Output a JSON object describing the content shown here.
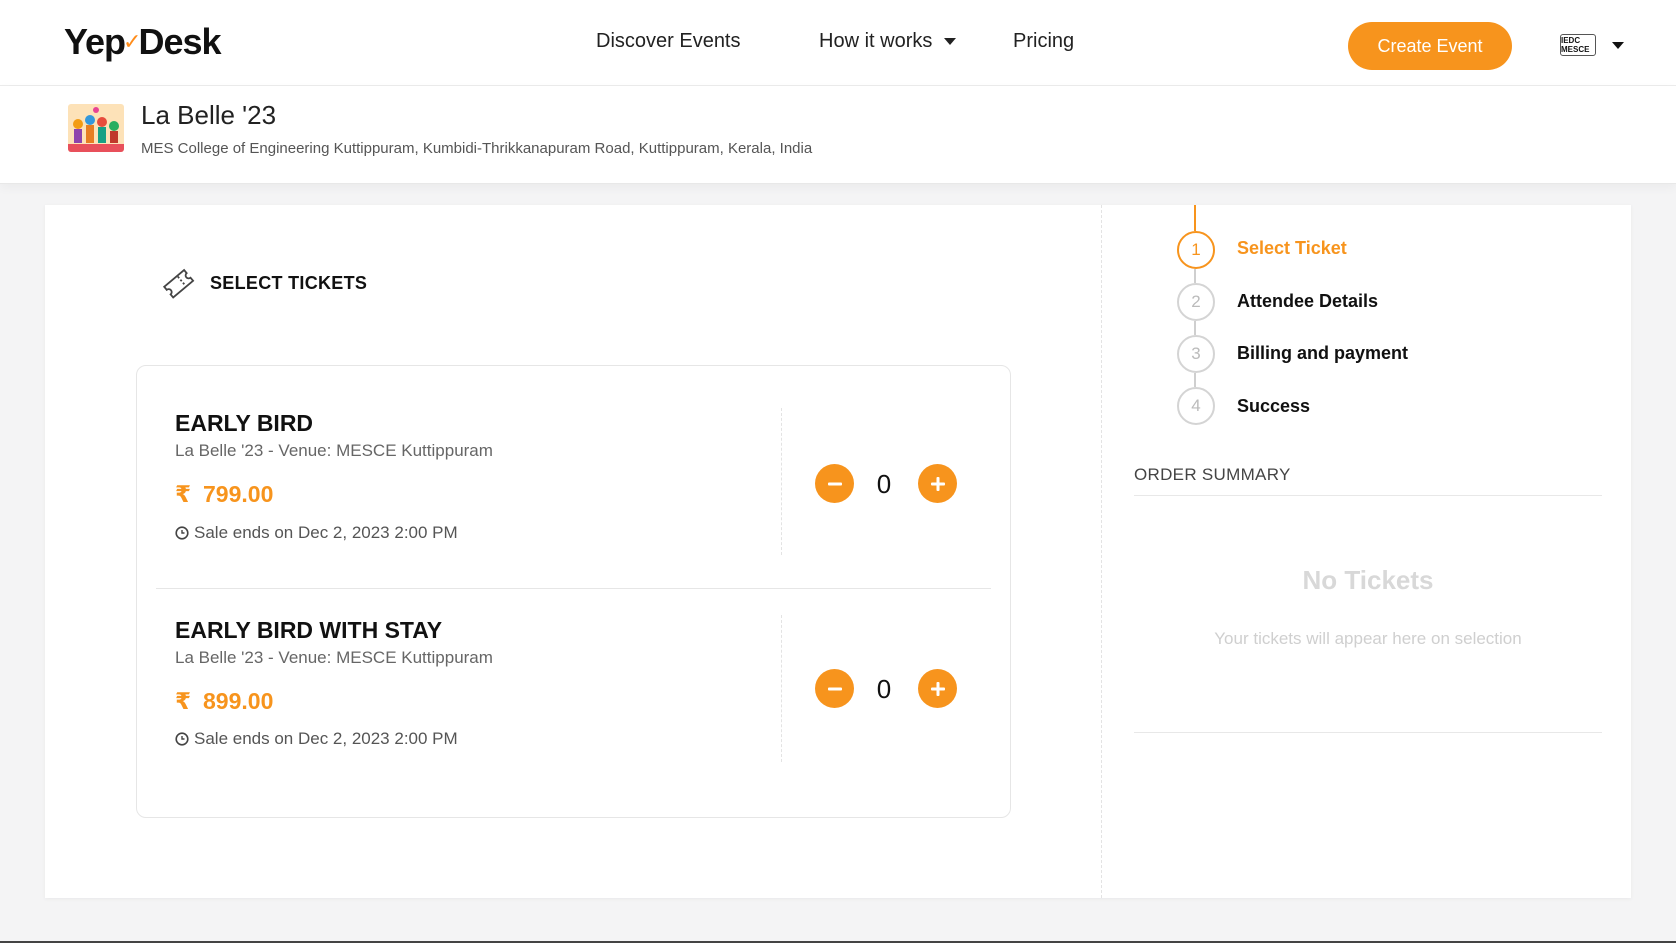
{
  "header": {
    "logo_text_1": "Yep",
    "logo_text_2": "Desk",
    "nav": {
      "discover": "Discover Events",
      "how_it_works": "How it works",
      "pricing": "Pricing"
    },
    "create_event": "Create Event",
    "profile_badge": "IEDC MESCE"
  },
  "event": {
    "title": "La Belle '23",
    "address": "MES College of Engineering Kuttippuram, Kumbidi-Thrikkanapuram Road, Kuttippuram, Kerala, India"
  },
  "tickets_section": {
    "heading": "SELECT TICKETS",
    "tickets": [
      {
        "name": "EARLY BIRD",
        "venue": "La Belle '23 - Venue: MESCE Kuttippuram",
        "currency": "₹",
        "price": "799.00",
        "sale_ends": "Sale ends on Dec 2, 2023 2:00 PM",
        "quantity": "0"
      },
      {
        "name": "EARLY BIRD WITH STAY",
        "venue": "La Belle '23 - Venue: MESCE Kuttippuram",
        "currency": "₹",
        "price": "899.00",
        "sale_ends": "Sale ends on Dec 2, 2023 2:00 PM",
        "quantity": "0"
      }
    ]
  },
  "steps": [
    {
      "number": "1",
      "label": "Select Ticket",
      "active": true
    },
    {
      "number": "2",
      "label": "Attendee Details",
      "active": false
    },
    {
      "number": "3",
      "label": "Billing and payment",
      "active": false
    },
    {
      "number": "4",
      "label": "Success",
      "active": false
    }
  ],
  "order_summary": {
    "heading": "ORDER SUMMARY",
    "empty_title": "No Tickets",
    "empty_subtitle": "Your tickets will appear here on selection"
  },
  "colors": {
    "accent": "#f7941d",
    "text": "#111111",
    "muted": "#666666"
  }
}
